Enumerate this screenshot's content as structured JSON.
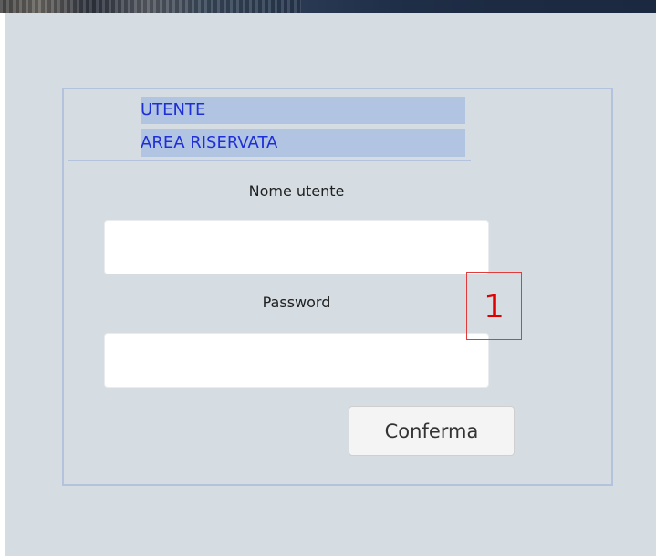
{
  "header": {
    "line1": "UTENTE",
    "line2": "AREA RISERVATA"
  },
  "form": {
    "username_label": "Nome utente",
    "username_value": "",
    "password_label": "Password",
    "password_value": "",
    "submit_label": "Conferma"
  },
  "annotation": {
    "marker_label": "1"
  },
  "colors": {
    "panel_bg": "#d5dde3",
    "header_bg": "#b1c4e2",
    "header_text": "#1f2fd6",
    "box_border": "#b3c3dd",
    "marker": "#e00000"
  }
}
